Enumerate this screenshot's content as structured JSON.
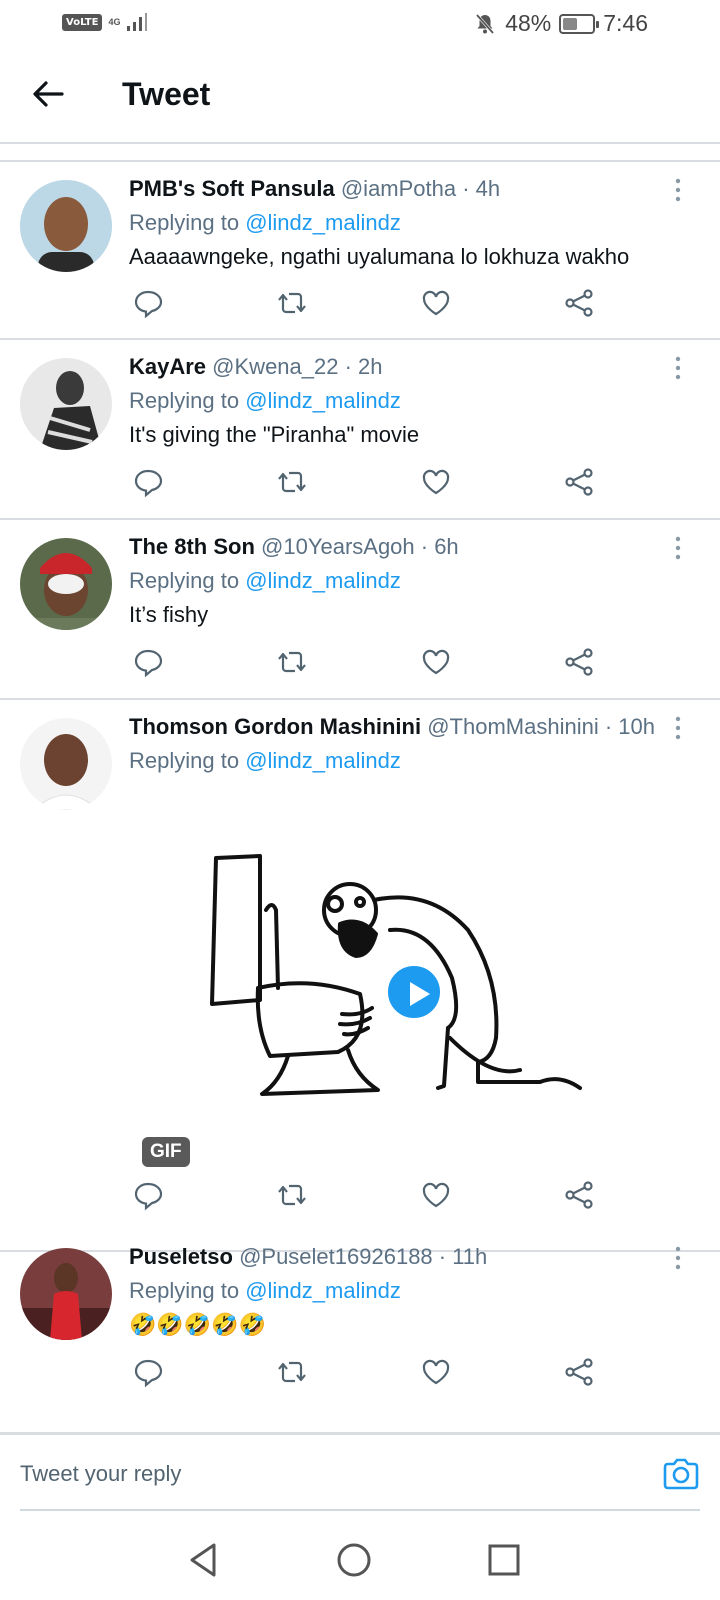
{
  "status_bar": {
    "volte": "VoLTE",
    "network": "4G",
    "battery_pct": "48%",
    "battery_level": 0.48,
    "time": "7:46"
  },
  "header": {
    "title": "Tweet"
  },
  "reply_prefix": "Replying to",
  "tweets": [
    {
      "name": "PMB's Soft Pansula",
      "meta": "@iamPotha · 4h",
      "replying_to": "@lindz_malindz",
      "text": "Aaaaawngeke, ngathi uyalumana lo lokhuza wakho"
    },
    {
      "name": "KayAre",
      "meta": "@Kwena_22 · 2h",
      "replying_to": "@lindz_malindz",
      "text": "It's giving the \"Piranha\" movie"
    },
    {
      "name": "The 8th Son",
      "meta": "@10YearsAgoh · 6h",
      "replying_to": "@lindz_malindz",
      "text": "It’s fishy"
    },
    {
      "name": "Thomson Gordon Mashinini",
      "meta": "@ThomMashinini · 10h",
      "replying_to": "@lindz_malindz",
      "text": "",
      "media_badge": "GIF"
    },
    {
      "name": "Puseletso",
      "meta": "@Puselet16926188 · 11h",
      "replying_to": "@lindz_malindz",
      "text": "🤣🤣🤣🤣🤣"
    }
  ],
  "composer": {
    "placeholder": "Tweet your reply"
  },
  "colors": {
    "accent": "#1d9bf0",
    "secondary_text": "#5b7083",
    "divider": "#d9dde1"
  },
  "icons": [
    "back-arrow-icon",
    "more-icon",
    "reply-icon",
    "retweet-icon",
    "like-icon",
    "share-icon",
    "camera-icon",
    "nav-back-icon",
    "nav-home-icon",
    "nav-recents-icon"
  ]
}
